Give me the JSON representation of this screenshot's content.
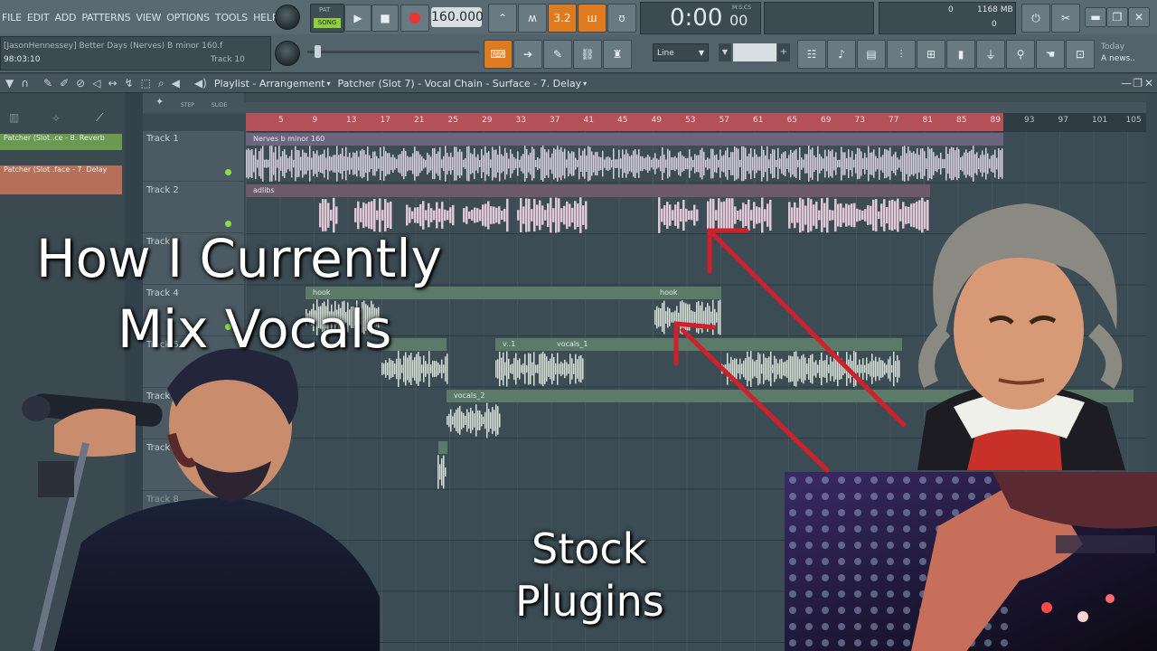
{
  "menu": [
    "FILE",
    "EDIT",
    "ADD",
    "PATTERNS",
    "VIEW",
    "OPTIONS",
    "TOOLS",
    "HELP"
  ],
  "transport": {
    "mode": "SONG",
    "pat_label": "PAT",
    "tempo": "160.000",
    "time": "0:00",
    "time_frac": "00",
    "time_unit": "M:S:CS"
  },
  "cpu": {
    "value": "0",
    "mem": "1168 MB",
    "poly": "0"
  },
  "hint_bar": {
    "line1": "[JasonHennessey] Better Days (Nerves) B minor 160.f",
    "line2_left": "98:03:10",
    "line2_right": "Track 10"
  },
  "snap": {
    "value": "Line"
  },
  "news": {
    "line1": "Today",
    "line2": "A news.."
  },
  "playlist_header": {
    "title": "Playlist - Arrangement",
    "crumbs": "Patcher (Slot 7) - Vocal Chain - Surface - 7. Delay"
  },
  "picker": [
    {
      "label": "Patcher (Slot..ce - 8. Reverb"
    },
    {
      "label": "Patcher (Slot..face - 7. Delay"
    }
  ],
  "tracks": [
    "Track 1",
    "Track 2",
    "Track 3",
    "Track 4",
    "Track 5",
    "Track 6",
    "Track 7",
    "Track 8"
  ],
  "ruler_ticks": [
    "5",
    "9",
    "13",
    "17",
    "21",
    "25",
    "29",
    "33",
    "37",
    "41",
    "45",
    "49",
    "53",
    "57",
    "61",
    "65",
    "69",
    "73",
    "77",
    "81",
    "85",
    "89",
    "93",
    "97",
    "101",
    "105"
  ],
  "clips": {
    "t1": "Nerves b minor 160",
    "t2": "adlibs",
    "t4a": "hook",
    "t4b": "hook",
    "t5a": "v..1",
    "t5b": "vocals_1",
    "t6": "vocals_2"
  },
  "overlay": {
    "headline_1": "How I Currently",
    "headline_2": "Mix Vocals",
    "caption_1": "Stock",
    "caption_2": "Plugins"
  },
  "colors": {
    "accent_orange": "#e07a1e",
    "ruler_red": "#b45058",
    "arrow_red": "#d1202a",
    "waveform": "#d7e0d6"
  }
}
